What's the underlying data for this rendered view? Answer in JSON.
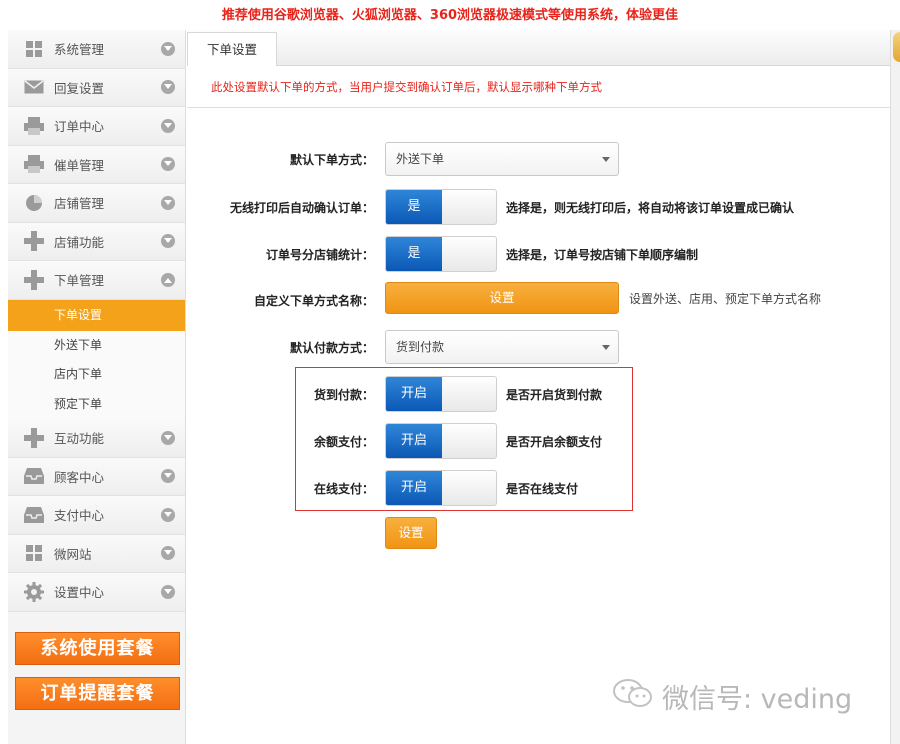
{
  "banner": {
    "text": "推荐使用谷歌浏览器、火狐浏览器、360浏览器极速模式等使用系统，体验更佳"
  },
  "sidebar": {
    "items_top": [
      {
        "label": "系统管理",
        "icon": "grid-icon"
      },
      {
        "label": "回复设置",
        "icon": "mail-icon"
      },
      {
        "label": "订单中心",
        "icon": "printer-icon"
      },
      {
        "label": "催单管理",
        "icon": "printer-icon"
      },
      {
        "label": "店铺管理",
        "icon": "pie-icon"
      },
      {
        "label": "店铺功能",
        "icon": "plus-icon"
      },
      {
        "label": "下单管理",
        "icon": "plus-icon"
      }
    ],
    "sub_items": [
      {
        "label": "下单设置",
        "active": true
      },
      {
        "label": "外送下单"
      },
      {
        "label": "店内下单"
      },
      {
        "label": "预定下单"
      }
    ],
    "items_bottom": [
      {
        "label": "互动功能",
        "icon": "plus-icon"
      },
      {
        "label": "顾客中心",
        "icon": "inbox-icon"
      },
      {
        "label": "支付中心",
        "icon": "inbox-icon"
      },
      {
        "label": "微网站",
        "icon": "grid-icon"
      },
      {
        "label": "设置中心",
        "icon": "gear-icon"
      }
    ],
    "promo1": "系统使用套餐",
    "promo2": "订单提醒套餐"
  },
  "main": {
    "tab": "下单设置",
    "notice": "此处设置默认下单的方式，当用户提交到确认订单后，默认显示哪种下单方式",
    "default_order": {
      "label": "默认下单方式：",
      "value": "外送下单"
    },
    "auto_confirm": {
      "label": "无线打印后自动确认订单：",
      "toggle": "是",
      "desc": "选择是，则无线打印后，将自动将该订单设置成已确认"
    },
    "order_no": {
      "label": "订单号分店铺统计：",
      "toggle": "是",
      "desc": "选择是，订单号按店铺下单顺序编制"
    },
    "custom_name": {
      "label": "自定义下单方式名称：",
      "button": "设置",
      "desc": "设置外送、店用、预定下单方式名称"
    },
    "default_pay": {
      "label": "默认付款方式：",
      "value": "货到付款"
    },
    "cod": {
      "label": "货到付款：",
      "toggle": "开启",
      "desc": "是否开启货到付款"
    },
    "balance": {
      "label": "余额支付：",
      "toggle": "开启",
      "desc": "是否开启余额支付"
    },
    "online": {
      "label": "在线支付：",
      "toggle": "开启",
      "desc": "是否在线支付"
    },
    "save_button": "设置"
  },
  "watermark": {
    "text": "微信号: veding"
  },
  "colors": {
    "accent": "#f5a21b",
    "toggle_blue": "#0b58b6",
    "alert_red": "#e8231a"
  }
}
